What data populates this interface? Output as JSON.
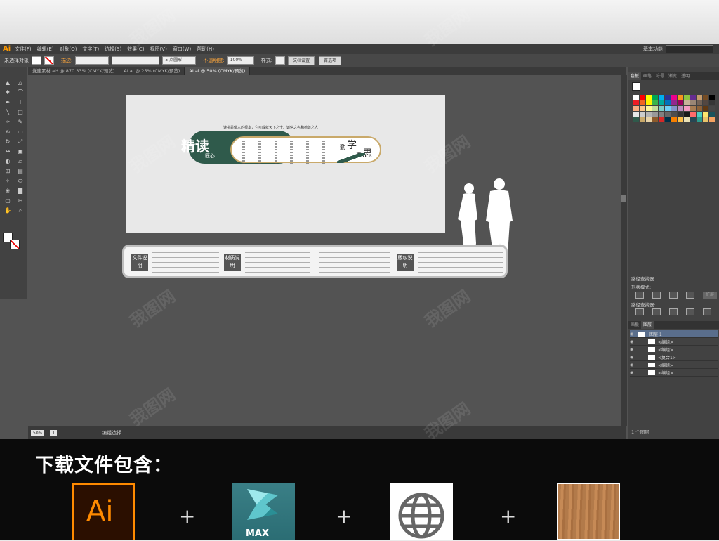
{
  "app": {
    "logo": "Ai",
    "menus": [
      "文件(F)",
      "编辑(E)",
      "对象(O)",
      "文字(T)",
      "选择(S)",
      "效果(C)",
      "视图(V)",
      "窗口(W)",
      "帮助(H)"
    ],
    "workspace": "基本功能"
  },
  "control_bar": {
    "selection_label": "未选择对象",
    "stroke_label": "描边:",
    "stroke_value": "5 点圆形",
    "opacity_label": "不透明度:",
    "opacity_value": "100%",
    "style_label": "样式:",
    "doc_setup": "文档设置",
    "preferences": "首选项"
  },
  "tabs": [
    {
      "label": "党建素材.ai* @ 870.33% (CMYK/预览)",
      "active": false
    },
    {
      "label": "AI.ai @ 25% (CMYK/预览)",
      "active": false
    },
    {
      "label": "AI.ai @ 50% (CMYK/预览)",
      "active": true
    }
  ],
  "artwork": {
    "motto": "读书是做人的根本，它可成就天下之士、诚信之名和德善之人",
    "calligraphy": "精读",
    "calligraphy_sub": "匠心",
    "learn_chars": [
      "勤",
      "学",
      "善",
      "思"
    ]
  },
  "legend": {
    "tags": [
      "文件说明",
      "材质说明",
      "版权说明"
    ]
  },
  "status": {
    "zoom": "50%",
    "page": "1",
    "mode": "编组选择"
  },
  "right_panel": {
    "swatch_tabs": [
      "色板",
      "画笔",
      "符号",
      "渐变",
      "透明"
    ],
    "pathfinder_title": "路径查找器",
    "shape_mode": "形状模式:",
    "expand": "扩展",
    "pathfinder_label": "路径查找器:",
    "layers_tabs": [
      "画板",
      "图层"
    ],
    "layers": [
      {
        "name": "图层 1",
        "selected": true
      },
      {
        "name": "<编组>",
        "selected": false
      },
      {
        "name": "<编组>",
        "selected": false
      },
      {
        "name": "<复合1>",
        "selected": false
      },
      {
        "name": "<编组>",
        "selected": false
      },
      {
        "name": "<编组>",
        "selected": false
      }
    ],
    "footer": "1 个图层"
  },
  "download": {
    "title": "下载文件包含：",
    "ai_label": "Ai",
    "max_label": "MAX",
    "plus": "+"
  },
  "watermark": "我图网",
  "colors": {
    "teal": "#2f5a4b",
    "gold": "#c9a96a",
    "ai_orange": "#ff8a00"
  }
}
